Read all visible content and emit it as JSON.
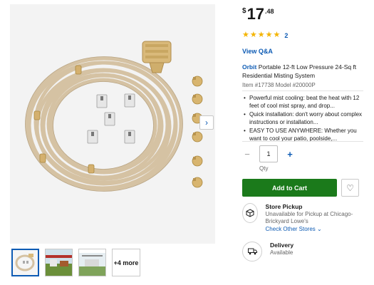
{
  "gallery": {
    "next_icon": "chevron-right-icon",
    "thumbnails": [
      "misting-kit",
      "patio-scene",
      "outdoor-scene"
    ],
    "more_label": "+4 more"
  },
  "price": {
    "currency": "$",
    "dollars": "17",
    "cents": ".48"
  },
  "rating": {
    "stars": 5,
    "count": "2"
  },
  "qa_link": "View Q&A",
  "product": {
    "brand": "Orbit",
    "title": "Portable 12-ft Low Pressure 24-Sq ft Residential Misting System",
    "item_model": "Item #17738 Model #20000P"
  },
  "highlights": [
    "Powerful mist cooling: beat the heat with 12 feet of cool mist spray, and drop...",
    "Quick installation: don't worry about complex instructions or installation...",
    "EASY TO USE ANYWHERE: Whether you want to cool your patio, poolside,..."
  ],
  "quantity": {
    "value": "1",
    "label": "Qty",
    "decrement_icon": "minus-icon",
    "increment_icon": "plus-icon"
  },
  "add_to_cart": "Add to Cart",
  "favorite_icon": "heart-icon",
  "store_pickup": {
    "title": "Store Pickup",
    "status": "Unavailable for Pickup at Chicago-Brickyard Lowe's",
    "link": "Check Other Stores",
    "icon": "box-icon"
  },
  "delivery": {
    "title": "Delivery",
    "status": "Available",
    "icon": "truck-icon"
  },
  "colors": {
    "accent_blue": "#0d5bb4",
    "cart_green": "#1b7a1b",
    "star_gold": "#f4b400"
  }
}
